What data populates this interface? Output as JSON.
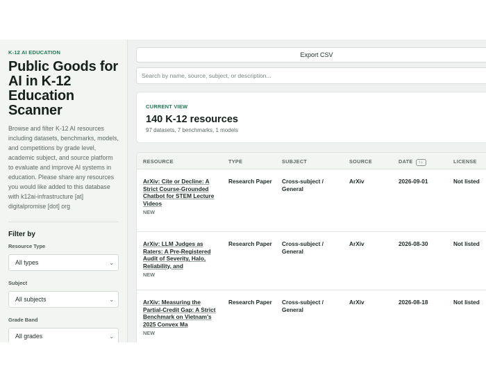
{
  "sidebar": {
    "eyebrow": "K-12 AI EDUCATION",
    "title": "Public Goods for AI in K-12 Education Scanner",
    "description": "Browse and filter K-12 AI resources including datasets, benchmarks, models, and competitions by grade level, academic subject, and source platform to evaluate and improve AI systems in education. Please share any resources you would like added to this database with k12ai-infrastructure [at] digitalpromise [dot] org",
    "filter_heading": "Filter by",
    "filters": [
      {
        "label": "Resource Type",
        "value": "All types"
      },
      {
        "label": "Subject",
        "value": "All subjects"
      },
      {
        "label": "Grade Band",
        "value": "All grades"
      }
    ]
  },
  "toolbar": {
    "export_label": "Export CSV",
    "search_placeholder": "Search by name, source, subject, or description..."
  },
  "view": {
    "eyebrow": "CURRENT VIEW",
    "count": "140 K-12 resources",
    "breakdown": "97 datasets, 7 benchmarks, 1 models"
  },
  "table": {
    "headers": {
      "resource": "RESOURCE",
      "type": "TYPE",
      "subject": "SUBJECT",
      "source": "SOURCE",
      "date": "DATE",
      "date_sort": "↑↓",
      "license": "LICENSE"
    },
    "rows": [
      {
        "title": "ArXiv: Cite or Decline: A Strict Course-Grounded Chatbot for STEM Lecture Videos",
        "badge": "NEW",
        "type": "Research Paper",
        "subject": "Cross-subject / General",
        "source": "ArXiv",
        "date": "2026-09-01",
        "license": "Not listed"
      },
      {
        "title": "ArXiv: LLM Judges as Raters: A Pre-Registered Audit of Severity, Halo, Reliability, and",
        "badge": "NEW",
        "type": "Research Paper",
        "subject": "Cross-subject / General",
        "source": "ArXiv",
        "date": "2026-08-30",
        "license": "Not listed"
      },
      {
        "title": "ArXiv: Measuring the Partial-Credit Gap: A Strict Benchmark on Vietnam's 2025 Convex Ma",
        "badge": "NEW",
        "type": "Research Paper",
        "subject": "Cross-subject / General",
        "source": "ArXiv",
        "date": "2026-08-18",
        "license": "Not listed"
      }
    ]
  }
}
